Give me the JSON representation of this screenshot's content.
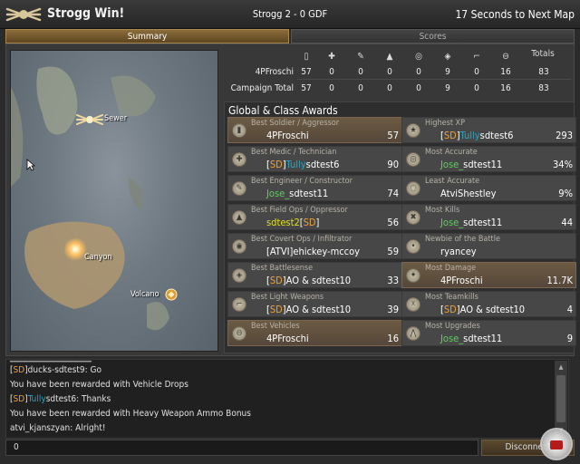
{
  "header": {
    "title": "Strogg Win!",
    "server": "Strogg 2 - 0 GDF",
    "countdown": "17 Seconds to Next Map"
  },
  "tabs": [
    {
      "label": "Summary",
      "active": true
    },
    {
      "label": "Scores",
      "active": false
    }
  ],
  "map": {
    "labels": [
      "Sewer",
      "Canyon",
      "Volcano"
    ]
  },
  "stats": {
    "icons": [
      "soldier-icon",
      "medic-icon",
      "engineer-icon",
      "fieldops-icon",
      "covertops-icon",
      "battlesense-icon",
      "lightweapons-icon",
      "vehicles-icon"
    ],
    "totals_label": "Totals",
    "rows": [
      {
        "label": "4PFroschi",
        "values": [
          "57",
          "0",
          "0",
          "0",
          "0",
          "9",
          "0",
          "16"
        ],
        "total": "83"
      },
      {
        "label": "Campaign Total",
        "values": [
          "57",
          "0",
          "0",
          "0",
          "0",
          "9",
          "0",
          "16"
        ],
        "total": "83"
      }
    ]
  },
  "awards_title": "Global & Class Awards",
  "awards": [
    {
      "title": "Best Soldier / Aggressor",
      "name_parts": [
        {
          "t": "4PFroschi",
          "c": ""
        }
      ],
      "value": "57",
      "icon": "soldier-award-icon"
    },
    {
      "title": "Highest XP",
      "name_parts": [
        {
          "t": "[",
          "c": ""
        },
        {
          "t": "SD",
          "c": "c-or"
        },
        {
          "t": "]",
          "c": ""
        },
        {
          "t": "Tully",
          "c": "c-cy"
        },
        {
          "t": "sdtest6",
          "c": ""
        }
      ],
      "value": "293",
      "icon": "xp-award-icon"
    },
    {
      "title": "Best Medic / Technician",
      "name_parts": [
        {
          "t": "[",
          "c": ""
        },
        {
          "t": "SD",
          "c": "c-or"
        },
        {
          "t": "]",
          "c": ""
        },
        {
          "t": "Tully",
          "c": "c-cy"
        },
        {
          "t": "sdtest6",
          "c": ""
        }
      ],
      "value": "90",
      "icon": "medic-award-icon"
    },
    {
      "title": "Most Accurate",
      "name_parts": [
        {
          "t": "Jose_",
          "c": "c-gr"
        },
        {
          "t": "sdtest11",
          "c": ""
        }
      ],
      "value": "34%",
      "icon": "accurate-award-icon"
    },
    {
      "title": "Best Engineer / Constructor",
      "name_parts": [
        {
          "t": "Jose_",
          "c": "c-gr"
        },
        {
          "t": "sdtest11",
          "c": ""
        }
      ],
      "value": "74",
      "icon": "engineer-award-icon"
    },
    {
      "title": "Least Accurate",
      "name_parts": [
        {
          "t": "AtviShestley",
          "c": ""
        }
      ],
      "value": "9%",
      "icon": "least-accurate-award-icon"
    },
    {
      "title": "Best Field Ops / Oppressor",
      "name_parts": [
        {
          "t": "sdtest2",
          "c": "c-ye"
        },
        {
          "t": "[",
          "c": ""
        },
        {
          "t": "SD",
          "c": "c-or"
        },
        {
          "t": "]",
          "c": ""
        }
      ],
      "value": "56",
      "icon": "fieldops-award-icon"
    },
    {
      "title": "Most Kills",
      "name_parts": [
        {
          "t": "Jose_",
          "c": "c-gr"
        },
        {
          "t": "sdtest11",
          "c": ""
        }
      ],
      "value": "44",
      "icon": "kills-award-icon"
    },
    {
      "title": "Best Covert Ops / Infiltrator",
      "name_parts": [
        {
          "t": "[ATVI]ehickey-mccoy",
          "c": ""
        }
      ],
      "value": "59",
      "icon": "covert-award-icon"
    },
    {
      "title": "Newbie of the Battle",
      "name_parts": [
        {
          "t": "ryancey",
          "c": ""
        }
      ],
      "value": "",
      "icon": "newbie-award-icon"
    },
    {
      "title": "Best Battlesense",
      "name_parts": [
        {
          "t": "[",
          "c": ""
        },
        {
          "t": "SD",
          "c": "c-or"
        },
        {
          "t": "]AO & sdtest10",
          "c": ""
        }
      ],
      "value": "33",
      "icon": "battlesense-award-icon"
    },
    {
      "title": "Most Damage",
      "name_parts": [
        {
          "t": "4PFroschi",
          "c": ""
        }
      ],
      "value": "11.7K",
      "icon": "damage-award-icon"
    },
    {
      "title": "Best Light Weapons",
      "name_parts": [
        {
          "t": "[",
          "c": ""
        },
        {
          "t": "SD",
          "c": "c-or"
        },
        {
          "t": "]AO & sdtest10",
          "c": ""
        }
      ],
      "value": "39",
      "icon": "lightweapons-award-icon"
    },
    {
      "title": "Most Teamkills",
      "name_parts": [
        {
          "t": "[",
          "c": ""
        },
        {
          "t": "SD",
          "c": "c-or"
        },
        {
          "t": "]AO & sdtest10",
          "c": ""
        }
      ],
      "value": "4",
      "icon": "teamkills-award-icon"
    },
    {
      "title": "Best Vehicles",
      "name_parts": [
        {
          "t": "4PFroschi",
          "c": ""
        }
      ],
      "value": "16",
      "icon": "vehicles-award-icon"
    },
    {
      "title": "Most Upgrades",
      "name_parts": [
        {
          "t": "Jose_",
          "c": "c-gr"
        },
        {
          "t": "sdtest11",
          "c": ""
        }
      ],
      "value": "9",
      "icon": "upgrades-award-icon"
    }
  ],
  "chat": [
    [
      {
        "t": "[",
        "c": ""
      },
      {
        "t": "SD",
        "c": "c-or"
      },
      {
        "t": "]ducks-sdtest9: Go",
        "c": ""
      }
    ],
    [
      {
        "t": "You have been rewarded with Vehicle Drops",
        "c": ""
      }
    ],
    [
      {
        "t": "[",
        "c": ""
      },
      {
        "t": "SD",
        "c": "c-or"
      },
      {
        "t": "]",
        "c": ""
      },
      {
        "t": "Tully",
        "c": "c-cy"
      },
      {
        "t": "sdtest6: Thanks",
        "c": ""
      }
    ],
    [
      {
        "t": "You have been rewarded with Heavy Weapon Ammo Bonus",
        "c": ""
      }
    ],
    [
      {
        "t": "atvi_kjanszyan: Alright!",
        "c": ""
      }
    ]
  ],
  "chat_input_value": "0",
  "disconnect_label": "Disconnect"
}
